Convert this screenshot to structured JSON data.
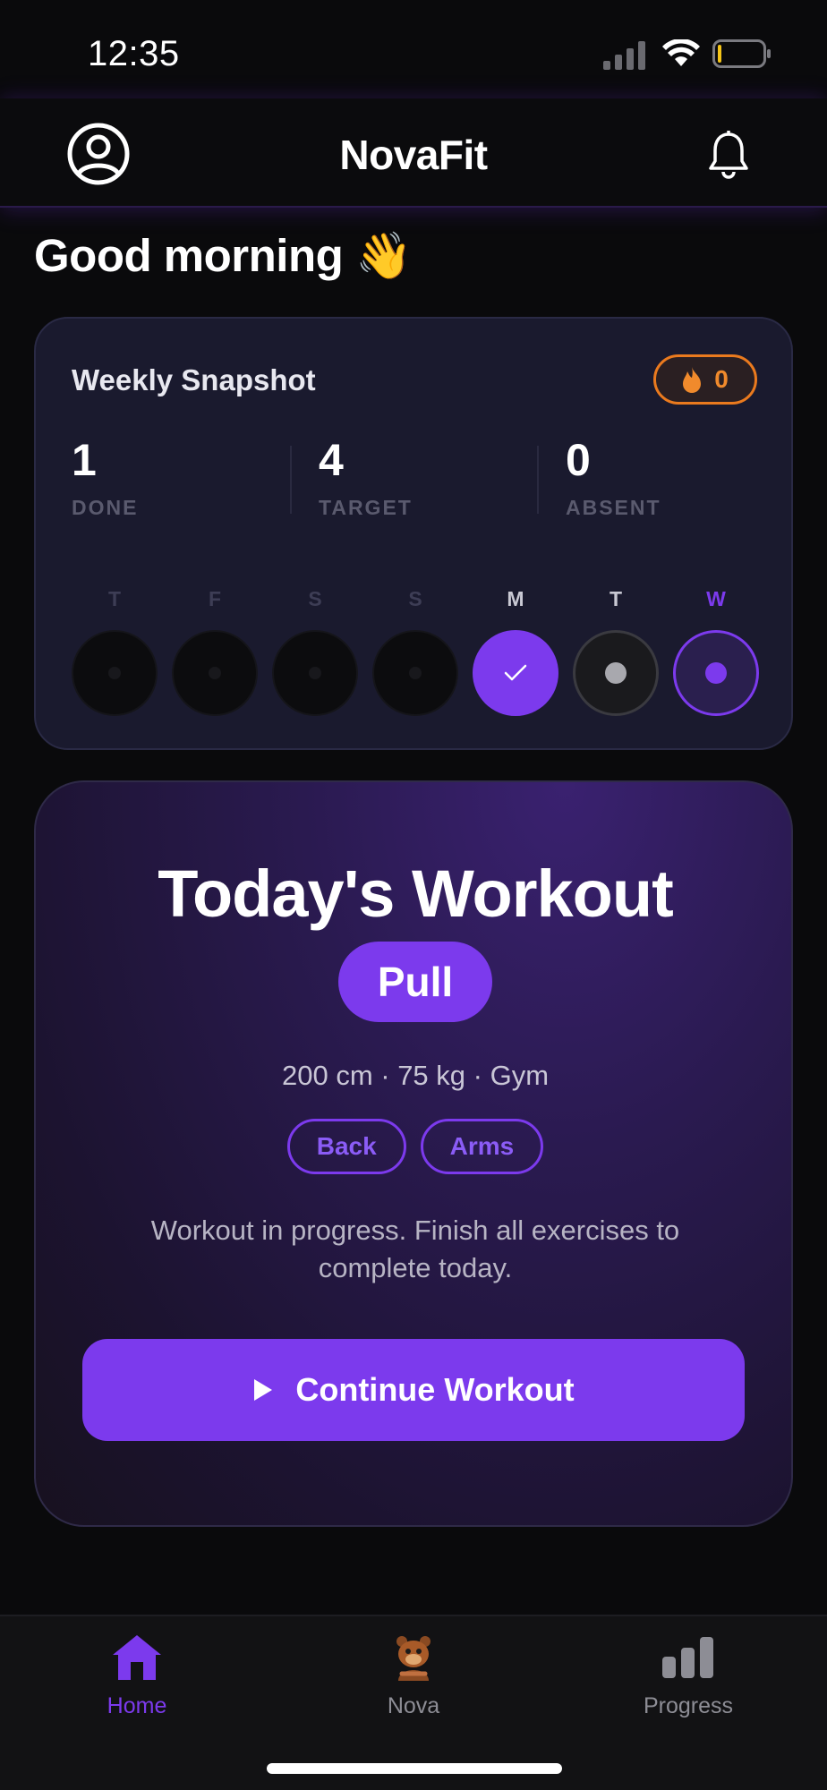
{
  "status_bar": {
    "time": "12:35"
  },
  "header": {
    "title": "NovaFit"
  },
  "greeting": "Good morning 👋",
  "snapshot": {
    "title": "Weekly Snapshot",
    "streak": "0",
    "stats": [
      {
        "value": "1",
        "label": "DONE"
      },
      {
        "value": "4",
        "label": "TARGET"
      },
      {
        "value": "0",
        "label": "ABSENT"
      }
    ],
    "days": [
      {
        "label": "T",
        "state": "empty"
      },
      {
        "label": "F",
        "state": "empty"
      },
      {
        "label": "S",
        "state": "empty"
      },
      {
        "label": "S",
        "state": "empty"
      },
      {
        "label": "M",
        "state": "done"
      },
      {
        "label": "T",
        "state": "rest"
      },
      {
        "label": "W",
        "state": "today"
      }
    ]
  },
  "workout": {
    "heading": "Today's Workout",
    "split": "Pull",
    "meta": "200 cm · 75 kg · Gym",
    "tags": [
      "Back",
      "Arms"
    ],
    "status": "Workout in progress. Finish all exercises to complete today.",
    "button_label": "Continue Workout"
  },
  "tabs": [
    {
      "label": "Home",
      "icon": "house-icon",
      "active": true
    },
    {
      "label": "Nova",
      "icon": "nova-mascot-icon",
      "active": false
    },
    {
      "label": "Progress",
      "icon": "bar-chart-icon",
      "active": false
    }
  ],
  "colors": {
    "accent": "#7c3aed",
    "streak": "#ea7a1e",
    "background": "#0a0a0c",
    "card": "#1a1a2e"
  }
}
